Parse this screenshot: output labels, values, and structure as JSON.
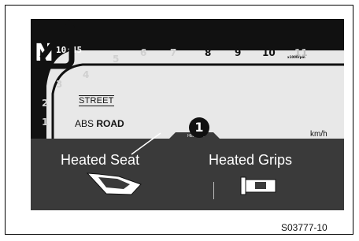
{
  "cluster": {
    "gear": "N",
    "clock": "10:45",
    "rpm_ticks": [
      "1",
      "2",
      "3",
      "4",
      "5",
      "6",
      "7",
      "8",
      "9",
      "10",
      "11"
    ],
    "rpm_scale": "x1000rpm",
    "ride_mode": "STREET",
    "abs_label": "ABS",
    "abs_mode": "ROAD",
    "speed_unit": "km/h",
    "menu_tab": "HEATING"
  },
  "menu": {
    "heated_seat": "Heated Seat",
    "heated_grips": "Heated Grips"
  },
  "annotation": {
    "callout_number": "1"
  },
  "figure_code": "S03777-10",
  "icons": {
    "seat": "heated-seat-icon",
    "grips": "heated-grips-icon",
    "speed_placeholder": "speed-indicator-icon"
  }
}
